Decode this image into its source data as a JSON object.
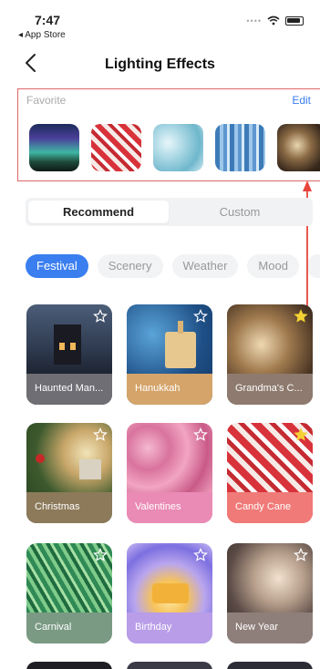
{
  "status": {
    "time": "7:47",
    "back_app": "◂ App Store"
  },
  "nav": {
    "title": "Lighting Effects"
  },
  "favorite": {
    "label": "Favorite",
    "edit": "Edit",
    "thumbs": [
      {
        "name": "aurora"
      },
      {
        "name": "candy-cane"
      },
      {
        "name": "ice"
      },
      {
        "name": "icicles"
      },
      {
        "name": "grandmas-christmas"
      }
    ]
  },
  "segment": {
    "recommend": "Recommend",
    "custom": "Custom"
  },
  "categories": [
    "Festival",
    "Scenery",
    "Weather",
    "Mood"
  ],
  "cards": [
    {
      "label": "Haunted Man...",
      "starred": false
    },
    {
      "label": "Hanukkah",
      "starred": false
    },
    {
      "label": "Grandma's C...",
      "starred": true
    },
    {
      "label": "Christmas",
      "starred": false
    },
    {
      "label": "Valentines",
      "starred": false
    },
    {
      "label": "Candy Cane",
      "starred": true
    },
    {
      "label": "Carnival",
      "starred": false
    },
    {
      "label": "Birthday",
      "starred": false
    },
    {
      "label": "New Year",
      "starred": false
    }
  ],
  "colors": {
    "accent": "#3a7ef0",
    "highlight": "#e06666",
    "star_filled": "#f5d233"
  }
}
